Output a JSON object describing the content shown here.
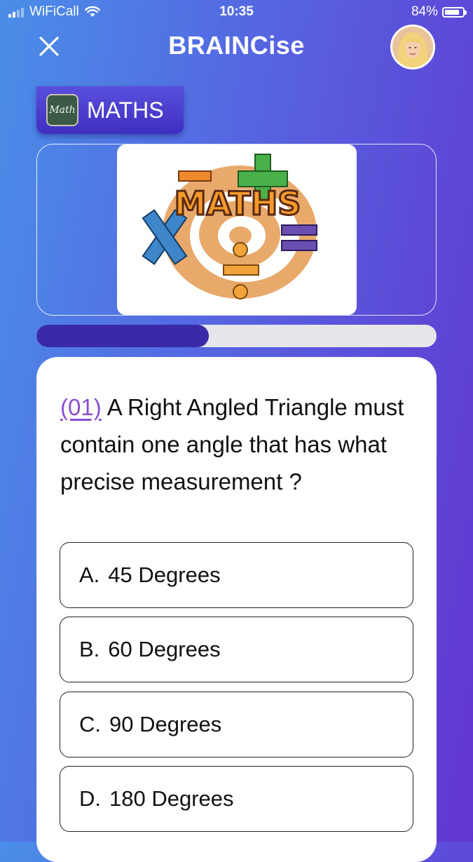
{
  "status_bar": {
    "carrier": "WiFiCall",
    "time": "10:35",
    "battery_percent": "84%",
    "battery_level": 0.84,
    "signal_bars": 2
  },
  "header": {
    "title": "BRAINCise",
    "close_icon": "close-icon",
    "avatar": "user-avatar"
  },
  "subject": {
    "label": "MATHS",
    "icon_text": "Math"
  },
  "banner_image": {
    "text": "MATHS"
  },
  "progress": {
    "value": 0.43
  },
  "question": {
    "number": "(01)",
    "text": "A Right Angled Triangle must contain one angle that has what precise measurement ?"
  },
  "options": [
    {
      "letter": "A.",
      "text": "45 Degrees"
    },
    {
      "letter": "B.",
      "text": "60 Degrees"
    },
    {
      "letter": "C.",
      "text": "90 Degrees"
    },
    {
      "letter": "D.",
      "text": "180 Degrees"
    }
  ],
  "colors": {
    "gradient_start": "#4a8ee8",
    "gradient_end": "#6235cf",
    "progress_fill": "#3a2aa8",
    "question_number": "#8a4fd1"
  }
}
